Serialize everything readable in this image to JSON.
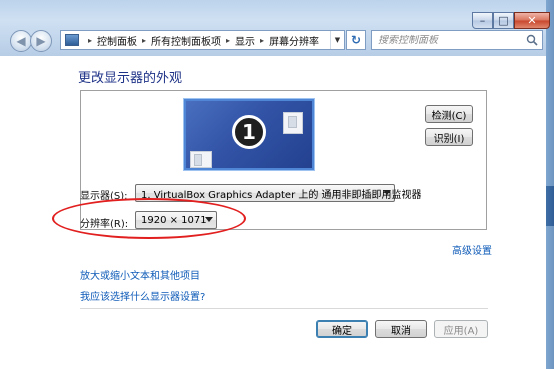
{
  "window": {
    "minimize_glyph": "–",
    "maximize_glyph": "□",
    "close_glyph": "✕"
  },
  "nav": {
    "back_glyph": "◀",
    "forward_glyph": "▶",
    "refresh_glyph": "↻"
  },
  "breadcrumb": {
    "items": [
      "控制面板",
      "所有控制面板项",
      "显示",
      "屏幕分辨率"
    ],
    "separator": "▸"
  },
  "search": {
    "placeholder": "搜索控制面板"
  },
  "page": {
    "title": "更改显示器的外观"
  },
  "preview": {
    "monitor_number": "1",
    "detect_label": "检测(C)",
    "identify_label": "识别(I)"
  },
  "settings": {
    "display_label": "显示器(S):",
    "display_value": "1. VirtualBox Graphics Adapter 上的 通用非即插即用监视器",
    "resolution_label": "分辨率(R):",
    "resolution_value": "1920 × 1071"
  },
  "links": {
    "advanced": "高级设置",
    "text_size": "放大或缩小文本和其他项目",
    "which_settings": "我应该选择什么显示器设置?"
  },
  "footer": {
    "ok_label": "确定",
    "cancel_label": "取消",
    "apply_label": "应用(A)"
  },
  "colors": {
    "title_blue": "#1e3287",
    "link_blue": "#0f5bb8",
    "highlight_red": "#e21f1f",
    "monitor_blue": "#3253a6"
  },
  "icons": [
    "control-panel-icon",
    "search-icon",
    "refresh-icon",
    "back-icon",
    "forward-icon",
    "dropdown-arrow-icon"
  ]
}
